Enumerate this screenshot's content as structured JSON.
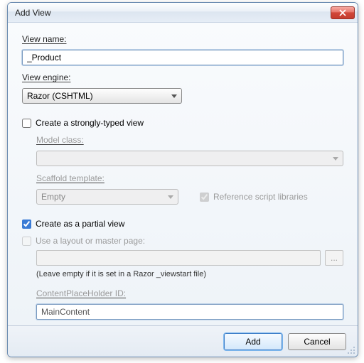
{
  "titlebar": {
    "title": "Add View"
  },
  "viewName": {
    "label": "View name:",
    "value": "_Product"
  },
  "engine": {
    "label": "View engine:",
    "selected": "Razor (CSHTML)"
  },
  "stronglyTyped": {
    "label": "Create a strongly-typed view",
    "checked": false
  },
  "modelClass": {
    "label": "Model class:",
    "selected": ""
  },
  "scaffold": {
    "label": "Scaffold template:",
    "selected": "Empty"
  },
  "refScript": {
    "label": "Reference script libraries",
    "checked": true
  },
  "partial": {
    "label": "Create as a partial view",
    "checked": true
  },
  "useLayout": {
    "label": "Use a layout or master page:",
    "checked": false
  },
  "layoutPath": {
    "value": ""
  },
  "layoutHint": {
    "text": "(Leave empty if it is set in a Razor _viewstart file)"
  },
  "cph": {
    "label": "ContentPlaceHolder ID:",
    "value": "MainContent"
  },
  "buttons": {
    "add": "Add",
    "cancel": "Cancel"
  },
  "browseLabel": "..."
}
